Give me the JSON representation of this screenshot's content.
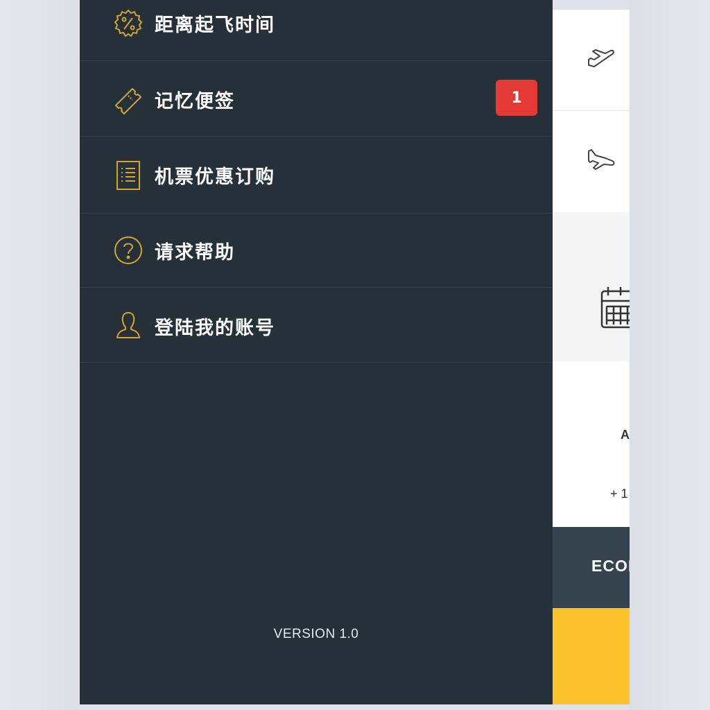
{
  "drawer": {
    "items": [
      {
        "label": "距离起飞时间",
        "icon": "percent-badge-icon"
      },
      {
        "label": "记忆便签",
        "icon": "ticket-icon",
        "badge": "1"
      },
      {
        "label": "机票优惠订购",
        "icon": "document-list-icon"
      },
      {
        "label": "请求帮助",
        "icon": "help-icon"
      },
      {
        "label": "登陆我的账号",
        "icon": "user-icon"
      }
    ],
    "version": "VERSION 1.0"
  },
  "background_panel": {
    "text_a": "A",
    "text_plus": "+ 1",
    "class_button": "ECOI",
    "icons": [
      "plane-departure-icon",
      "plane-arrival-icon",
      "calendar-icon"
    ]
  },
  "colors": {
    "drawer_bg": "#263038",
    "accent_gold": "#d4a531",
    "badge_red": "#e53935",
    "econ_bg": "#36444f",
    "cta_yellow": "#fcc22c"
  }
}
